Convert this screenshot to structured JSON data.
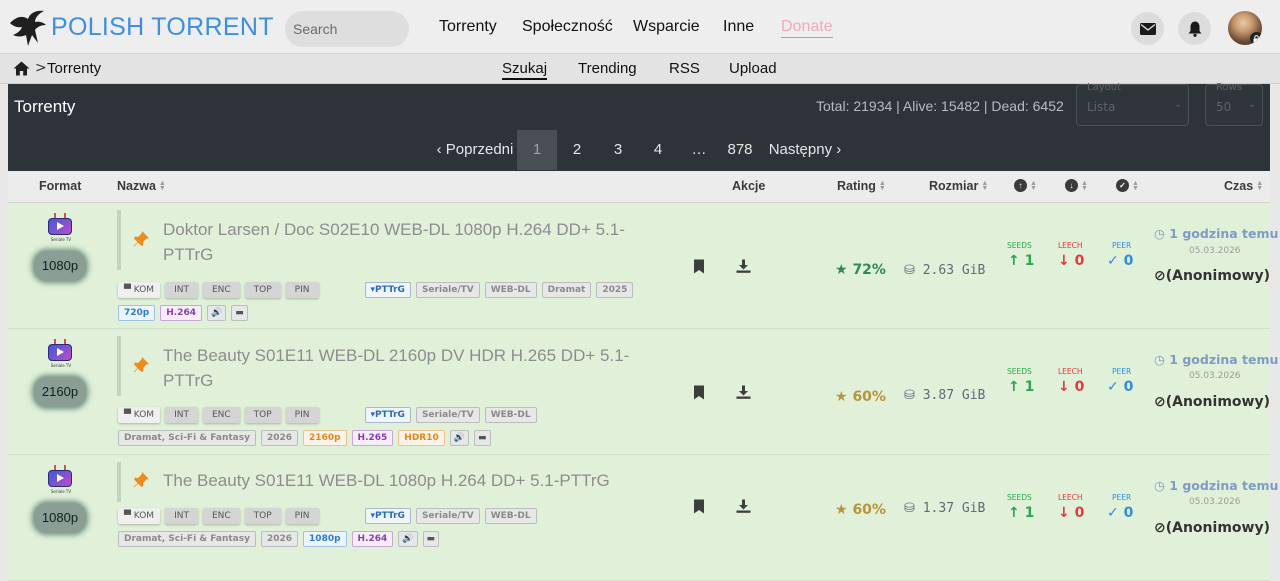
{
  "brand": {
    "logo_text": "POLISH TORRENT"
  },
  "search": {
    "placeholder": "Search"
  },
  "nav": {
    "torrenty": "Torrenty",
    "spolecznosc": "Społeczność",
    "wsparcie": "Wsparcie",
    "inne": "Inne",
    "donate": "Donate"
  },
  "breadcrumb": {
    "current": "Torrenty",
    "separator": ">"
  },
  "subnav": {
    "szukaj": "Szukaj",
    "trending": "Trending",
    "rss": "RSS",
    "upload": "Upload"
  },
  "panel": {
    "title": "Torrenty",
    "stats": "Total: 21934 | Alive: 15482 | Dead: 6452",
    "layout": {
      "label": "Layout",
      "value": "Lista"
    },
    "rows": {
      "label": "Rows",
      "value": "50"
    }
  },
  "pagination": {
    "prev": "‹ Poprzedni",
    "pages": [
      "1",
      "2",
      "3",
      "4",
      "…",
      "878"
    ],
    "next": "Następny ›",
    "current": "1"
  },
  "columns": {
    "format": "Format",
    "nazwa": "Nazwa",
    "akcje": "Akcje",
    "rating": "Rating",
    "rozmiar": "Rozmiar",
    "czas": "Czas"
  },
  "colors": {
    "rating_high": "#2e8b57",
    "rating_mid": "#b8943a",
    "seeds": "#2aa84a",
    "leech": "#e03b3b",
    "peer": "#2f8ee0"
  },
  "torrents": [
    {
      "res": "1080p",
      "title": "Doktor Larsen / Doc S02E10 WEB-DL 1080p H.264 DD+ 5.1-PTTrG",
      "flags": [
        "KOM",
        "INT",
        "ENC",
        "TOP",
        "PIN"
      ],
      "cats": [
        "PTTrG",
        "Seriale/TV",
        "WEB-DL",
        "Dramat",
        "2025"
      ],
      "extra": [
        "720p",
        "H.264"
      ],
      "rating": "72%",
      "size": "2.63 GiB",
      "seeds": "1",
      "leech": "0",
      "peer": "0",
      "seeds_label": "SEEDS",
      "leech_label": "LEECH",
      "peer_label": "PEER",
      "time": "1 godzina temu",
      "date": "05.03.2026",
      "uploader": "(Anonimowy)"
    },
    {
      "res": "2160p",
      "title": "The Beauty S01E11 WEB-DL 2160p DV HDR H.265 DD+ 5.1-PTTrG",
      "flags": [
        "KOM",
        "INT",
        "ENC",
        "TOP",
        "PIN"
      ],
      "cats": [
        "PTTrG",
        "Seriale/TV",
        "WEB-DL"
      ],
      "extra": [
        "Dramat, Sci-Fi & Fantasy",
        "2026",
        "2160p",
        "H.265",
        "HDR10"
      ],
      "rating": "60%",
      "size": "3.87 GiB",
      "seeds": "1",
      "leech": "0",
      "peer": "0",
      "seeds_label": "SEEDS",
      "leech_label": "LEECH",
      "peer_label": "PEER",
      "time": "1 godzina temu",
      "date": "05.03.2026",
      "uploader": "(Anonimowy)"
    },
    {
      "res": "1080p",
      "title": "The Beauty S01E11 WEB-DL 1080p H.264 DD+ 5.1-PTTrG",
      "flags": [
        "KOM",
        "INT",
        "ENC",
        "TOP",
        "PIN"
      ],
      "cats": [
        "PTTrG",
        "Seriale/TV",
        "WEB-DL"
      ],
      "extra": [
        "Dramat, Sci-Fi & Fantasy",
        "2026",
        "1080p",
        "H.264"
      ],
      "rating": "60%",
      "size": "1.37 GiB",
      "seeds": "1",
      "leech": "0",
      "peer": "0",
      "seeds_label": "SEEDS",
      "leech_label": "LEECH",
      "peer_label": "PEER",
      "time": "1 godzina temu",
      "date": "05.03.2026",
      "uploader": "(Anonimowy)"
    }
  ]
}
